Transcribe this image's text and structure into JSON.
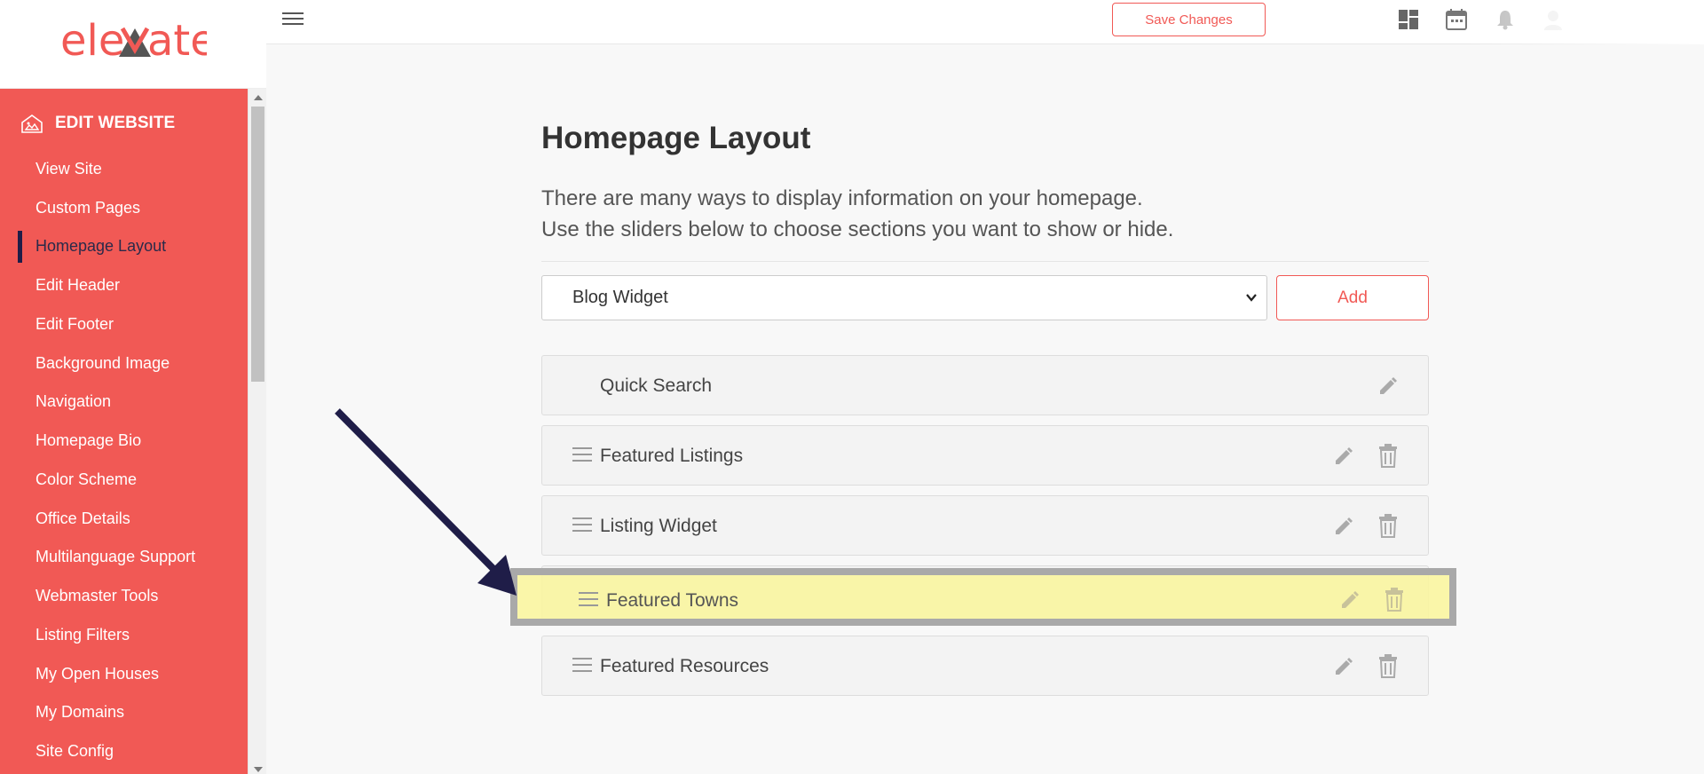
{
  "logo": {
    "text": "ele ate"
  },
  "sidebar": {
    "heading": "EDIT WEBSITE",
    "items": [
      {
        "label": "View Site"
      },
      {
        "label": "Custom Pages"
      },
      {
        "label": "Homepage Layout",
        "active": true
      },
      {
        "label": "Edit Header"
      },
      {
        "label": "Edit Footer"
      },
      {
        "label": "Background Image"
      },
      {
        "label": "Navigation"
      },
      {
        "label": "Homepage Bio"
      },
      {
        "label": "Color Scheme"
      },
      {
        "label": "Office Details"
      },
      {
        "label": "Multilanguage Support"
      },
      {
        "label": "Webmaster Tools"
      },
      {
        "label": "Listing Filters"
      },
      {
        "label": "My Open Houses"
      },
      {
        "label": "My Domains"
      },
      {
        "label": "Site Config"
      }
    ]
  },
  "topbar": {
    "save_label": "Save Changes",
    "icons": [
      "dashboard-icon",
      "calendar-icon",
      "bell-icon"
    ]
  },
  "main": {
    "title": "Homepage Layout",
    "desc_line1": "There are many ways to display information on your homepage.",
    "desc_line2": "Use the sliders below to choose sections you want to show or hide.",
    "select_value": "Blog Widget",
    "add_label": "Add",
    "sections": [
      {
        "label": "Quick Search",
        "draggable": false,
        "deletable": false
      },
      {
        "label": "Featured Listings",
        "draggable": true,
        "deletable": true
      },
      {
        "label": "Listing Widget",
        "draggable": true,
        "deletable": true
      },
      {
        "label": "Featured Towns",
        "draggable": true,
        "deletable": true,
        "highlighted": true
      },
      {
        "label": "Featured Resources",
        "draggable": true,
        "deletable": true
      }
    ]
  },
  "colors": {
    "accent": "#f15955",
    "arrow": "#1f1d48",
    "highlight": "#faf5a0"
  }
}
